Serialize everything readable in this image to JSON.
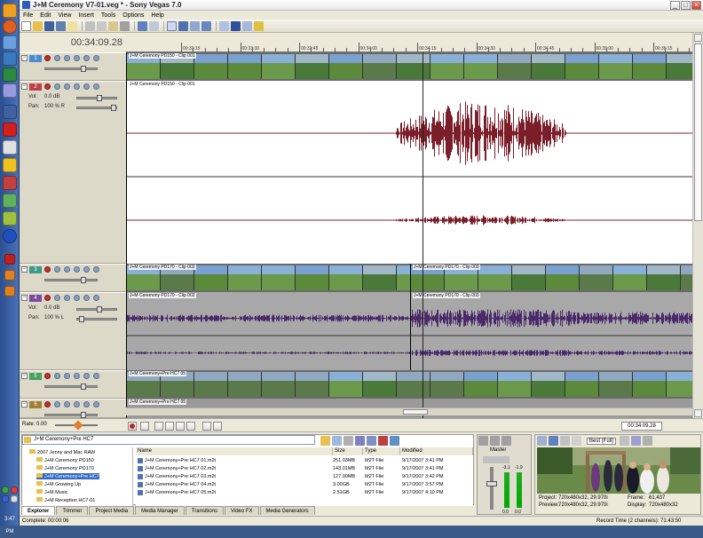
{
  "window": {
    "title": "J+M Ceremony V7-01.veg * - Sony Vegas 7.0",
    "controls": [
      "_",
      "□",
      "×"
    ]
  },
  "menu": [
    "File",
    "Edit",
    "View",
    "Insert",
    "Tools",
    "Options",
    "Help"
  ],
  "timeline": {
    "current_time": "00:34:09.28",
    "ruler_labels": [
      "00:33:15",
      "00:33:30",
      "00:33:45",
      "00:34:00",
      "00:34:15",
      "00:34:30",
      "00:34:45",
      "00:35:00",
      "00:35:15"
    ],
    "tracks": [
      {
        "num": "1",
        "type": "video",
        "clips": [
          "J+M Ceremony PD150 - Clip 001"
        ],
        "color": "#4a8ad0"
      },
      {
        "num": "2",
        "type": "audio",
        "clips": [
          "J+M Ceremony PD150 - Clip 001"
        ],
        "vol": "Vol:",
        "vol_value": "0.0 dB",
        "pan": "Pan:",
        "pan_value": "100 % R",
        "color": "#c0404a"
      },
      {
        "num": "3",
        "type": "video",
        "clips": [
          "J+M Ceremony PD170 - Clip 002",
          "J+M Ceremony PD170 - Clip 003"
        ],
        "color": "#3a9a8a"
      },
      {
        "num": "4",
        "type": "audio",
        "clips": [
          "J+M Ceremony PD170 - Clip 002",
          "J+M Ceremony PD170 - Clip 003"
        ],
        "vol": "Vol:",
        "vol_value": "0.0 dB",
        "pan": "Pan:",
        "pan_value": "100 % L",
        "color": "#7a4aa0"
      },
      {
        "num": "5",
        "type": "video",
        "clips": [
          "J+M Ceremony+Pre HC7 05"
        ],
        "color": "#4aa060"
      },
      {
        "num": "6",
        "type": "audio",
        "clips": [
          "J+M Ceremony+Pre HC7 05"
        ],
        "color": "#a08030"
      }
    ]
  },
  "transport": {
    "rate_label": "Rate: 0.00",
    "timecode": "00:34:09.28"
  },
  "explorer": {
    "path": "J+M Ceremony+Pre HC7",
    "tree": [
      "2007 Jenny and Mac RAW",
      "J+M Ceremony PD150",
      "J+M Ceremony PD170",
      "J+M Ceremony+Pre HC7",
      "J+M Growing Up",
      "J+M Music",
      "J+M Reception HC7-01"
    ],
    "columns": {
      "name": "Name",
      "size": "Size",
      "type": "Type",
      "modified": "Modified"
    },
    "files": [
      {
        "name": "J+M Ceremony+Pre HC7 01.m2t",
        "size": "251.03MB",
        "type": "M2T File",
        "modified": "9/17/2007 3:41 PM"
      },
      {
        "name": "J+M Ceremony+Pre HC7 02.m2t",
        "size": "143.01MB",
        "type": "M2T File",
        "modified": "9/17/2007 3:41 PM"
      },
      {
        "name": "J+M Ceremony+Pre HC7 03.m2t",
        "size": "127.00MB",
        "type": "M2T File",
        "modified": "9/17/2007 3:42 PM"
      },
      {
        "name": "J+M Ceremony+Pre HC7 04.m2t",
        "size": "3.00GB",
        "type": "M2T File",
        "modified": "9/17/2007 3:57 PM"
      },
      {
        "name": "J+M Ceremony+Pre HC7 05.m2t",
        "size": "2.51GB",
        "type": "M2T File",
        "modified": "9/17/2007 4:10 PM"
      }
    ],
    "tabs": [
      "Explorer",
      "Trimmer",
      "Project Media",
      "Media Manager",
      "Transitions",
      "Video FX",
      "Media Generators"
    ]
  },
  "mixer": {
    "label": "Master",
    "meter_ticks": [
      "-3.1",
      "-1.9"
    ],
    "values": [
      "0.0",
      "0.0"
    ]
  },
  "preview": {
    "quality": "Best (Full)",
    "project_label": "Project:",
    "project_value": "720x480x32, 29.970i",
    "preview_label": "Preview:",
    "preview_value": "720x480x32, 29.970i",
    "frame_label": "Frame:",
    "frame_value": "61,437",
    "display_label": "Display:",
    "display_value": "720x480x32"
  },
  "status": {
    "left": "Complete: 00:00:06",
    "right": "Record Time (2 channels): 71:43:50"
  },
  "clock": "3:47 PM"
}
